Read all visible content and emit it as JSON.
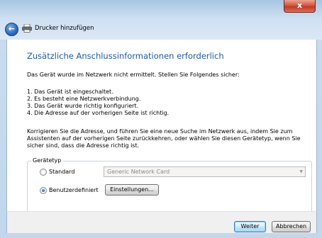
{
  "window": {
    "title": "Drucker hinzufügen",
    "close_label": "x"
  },
  "page": {
    "heading": "Zusätzliche Anschlussinformationen erforderlich",
    "intro": "Das Gerät wurde im Netzwerk nicht ermittelt. Stellen Sie Folgendes sicher:",
    "checklist": [
      "1. Das Gerät ist eingeschaltet.",
      "2. Es besteht eine Netzwerkverbindung.",
      "3. Das Gerät wurde richtig konfiguriert.",
      "4. Die Adresse auf der vorherigen Seite ist richtig."
    ],
    "instructions": "Korrigieren Sie die Adresse, und führen Sie eine neue Suche im Netzwerk aus, indem Sie zum Assistenten auf der vorherigen Seite zurückkehren, oder wählen Sie diesen Gerätetyp, wenn Sie sicher sind, dass die Adresse richtig ist."
  },
  "device_type": {
    "legend": "Gerätetyp",
    "standard_label": "Standard",
    "standard_value": "Generic Network Card",
    "custom_label": "Benutzerdefiniert",
    "settings_button": "Einstellungen...",
    "selected": "Benutzerdefiniert"
  },
  "footer": {
    "next_button": "Weiter",
    "cancel_button": "Abbrechen"
  },
  "icons": {
    "back": "back-arrow-icon",
    "printer": "printer-icon",
    "close": "close-icon",
    "dropdown": "chevron-down-icon"
  }
}
